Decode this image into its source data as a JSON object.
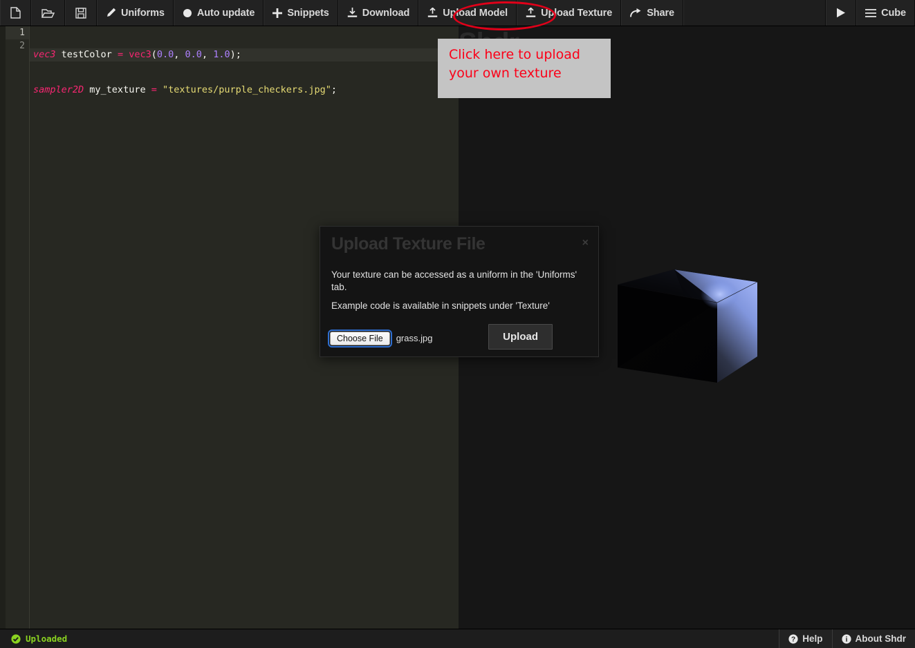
{
  "app": {
    "name": "Shdr",
    "watermark": "Shdr"
  },
  "toolbar": {
    "buttons": [
      {
        "id": "new",
        "label": "",
        "icon": "file-icon"
      },
      {
        "id": "open",
        "label": "",
        "icon": "folder-open-icon"
      },
      {
        "id": "save",
        "label": "",
        "icon": "save-icon"
      },
      {
        "id": "uniforms",
        "label": "Uniforms",
        "icon": "pencil-icon"
      },
      {
        "id": "auto-update",
        "label": "Auto update",
        "icon": "circle-icon"
      },
      {
        "id": "snippets",
        "label": "Snippets",
        "icon": "plus-icon"
      },
      {
        "id": "download",
        "label": "Download",
        "icon": "download-icon"
      },
      {
        "id": "upload-model",
        "label": "Upload Model",
        "icon": "upload-icon"
      },
      {
        "id": "upload-texture",
        "label": "Upload Texture",
        "icon": "upload-icon"
      },
      {
        "id": "share",
        "label": "Share",
        "icon": "share-arrow-icon"
      }
    ],
    "run_label": "",
    "run_icon": "play-icon",
    "model_label": "Cube",
    "model_icon": "hamburger-icon",
    "highlight_color": "#e00019"
  },
  "editor": {
    "line_numbers": [
      "1",
      "2"
    ],
    "lines": [
      {
        "tokens": [
          {
            "t": "vec3",
            "c": "tk-type"
          },
          {
            "t": " ",
            "c": "tk-punc"
          },
          {
            "t": "testColor",
            "c": "tk-name"
          },
          {
            "t": " ",
            "c": "tk-punc"
          },
          {
            "t": "=",
            "c": "tk-op"
          },
          {
            "t": " ",
            "c": "tk-punc"
          },
          {
            "t": "vec3",
            "c": "tk-fn"
          },
          {
            "t": "(",
            "c": "tk-punc"
          },
          {
            "t": "0.0",
            "c": "tk-num"
          },
          {
            "t": ", ",
            "c": "tk-punc"
          },
          {
            "t": "0.0",
            "c": "tk-num"
          },
          {
            "t": ", ",
            "c": "tk-punc"
          },
          {
            "t": "1.0",
            "c": "tk-num"
          },
          {
            "t": ");",
            "c": "tk-punc"
          }
        ]
      },
      {
        "tokens": [
          {
            "t": "sampler2D",
            "c": "tk-type"
          },
          {
            "t": " ",
            "c": "tk-punc"
          },
          {
            "t": "my_texture",
            "c": "tk-name"
          },
          {
            "t": " ",
            "c": "tk-punc"
          },
          {
            "t": "=",
            "c": "tk-op"
          },
          {
            "t": " ",
            "c": "tk-punc"
          },
          {
            "t": "\"textures/purple_checkers.jpg\"",
            "c": "tk-str"
          },
          {
            "t": ";",
            "c": "tk-punc"
          }
        ]
      }
    ],
    "plain_text": "vec3 testColor = vec3(0.0, 0.0, 1.0);\nsampler2D my_texture = \"textures/purple_checkers.jpg\";"
  },
  "annotation": {
    "tooltip_line1": "Click here to upload",
    "tooltip_line2": "your own texture",
    "tooltip_bg": "#c4c4c4",
    "tooltip_color": "#fb0018",
    "ellipse_target": "Upload Texture"
  },
  "modal": {
    "title": "Upload Texture File",
    "close_label": "×",
    "body_1": "Your texture can be accessed as a uniform in the 'Uniforms' tab.",
    "body_2": "Example code is available in snippets under 'Texture'",
    "choose_file_label": "Choose File",
    "selected_file": "grass.jpg",
    "upload_label": "Upload"
  },
  "viewport": {
    "model": "Cube",
    "background": "#161616",
    "highlight_color": "#8fa8f0"
  },
  "statusbar": {
    "status_text": "Uploaded",
    "status_icon": "check-circle-icon",
    "status_color": "#8bd321",
    "help_label": "Help",
    "help_icon": "question-circle-icon",
    "about_label": "About Shdr",
    "about_icon": "info-circle-icon"
  }
}
